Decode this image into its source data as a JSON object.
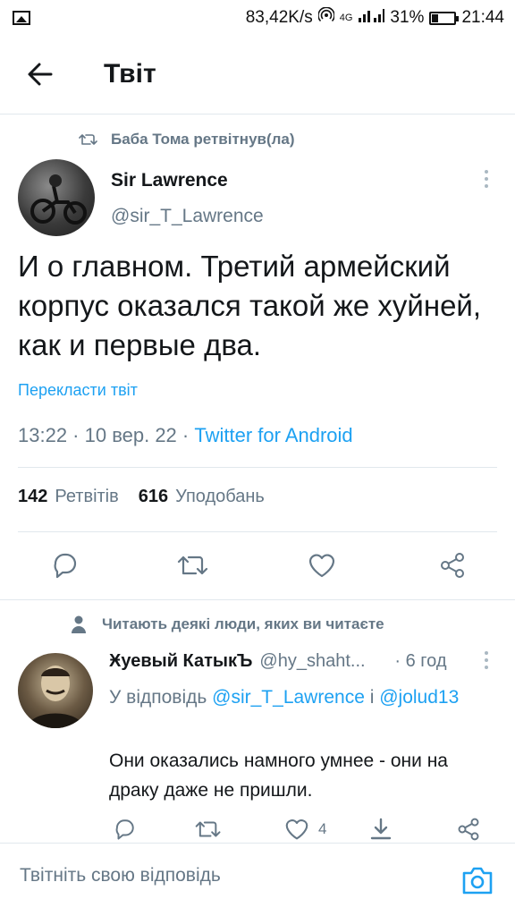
{
  "status_bar": {
    "speed": "83,42K/s",
    "network": "4G",
    "battery": "31%",
    "battery_level": 0.31,
    "time": "21:44"
  },
  "header": {
    "title": "Твіт"
  },
  "retweet_context": "Баба Тома ретвітнув(ла)",
  "tweet": {
    "display_name": "Sir Lawrence",
    "handle": "@sir_T_Lawrence",
    "text": "И о главном. Третий армейский корпус оказался такой же хуйней, как и первые два.",
    "translate": "Перекласти твіт",
    "time_date": "13:22 · 10 вер. 22 · ",
    "source": "Twitter for Android",
    "retweets_count": "142",
    "retweets_label": "Ретвітів",
    "likes_count": "616",
    "likes_label": "Уподобань"
  },
  "reply_context": "Читають деякі люди, яких ви читаєте",
  "reply": {
    "display_name": "Ӿуевый КатыкЪ",
    "handle": "@hy_shaht...",
    "age": "· 6 год",
    "replying_prefix": "У відповідь ",
    "mention1": "@sir_T_Lawrence",
    "joiner": " і ",
    "mention2": "@jolud13",
    "text": "Они оказались намного умнее - они на драку даже не пришли.",
    "likes": "4"
  },
  "compose": {
    "placeholder": "Твітніть свою відповідь"
  },
  "colors": {
    "accent": "#1da1f2",
    "muted": "#657786",
    "divider": "#e1e8ed"
  }
}
